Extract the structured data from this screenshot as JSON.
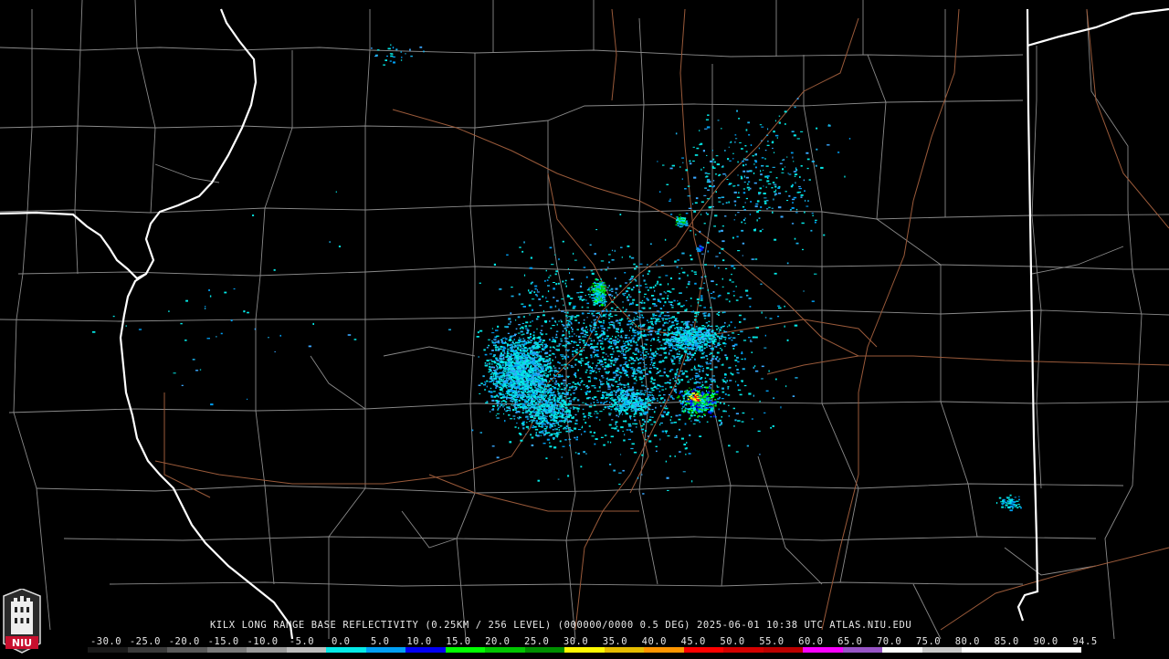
{
  "title": "KILX LONG RANGE BASE REFLECTIVITY (0.25KM / 256 LEVEL) (000000/0000 0.5 DEG) 2025-06-01 10:38 UTC  ATLAS.NIU.EDU",
  "logo": {
    "text": "NIU",
    "icon": "niu-castle-icon"
  },
  "scale": {
    "labels": [
      "-30.0",
      "-25.0",
      "-20.0",
      "-15.0",
      "-10.0",
      "-5.0",
      "0.0",
      "5.0",
      "10.0",
      "15.0",
      "20.0",
      "25.0",
      "30.0",
      "35.0",
      "40.0",
      "45.0",
      "50.0",
      "55.0",
      "60.0",
      "65.0",
      "70.0",
      "75.0",
      "80.0",
      "85.0",
      "90.0",
      "94.5"
    ],
    "colors": [
      "#1a1a1a",
      "#3a3a3a",
      "#5a5a5a",
      "#7a7a7a",
      "#9a9a9a",
      "#bcbcbc",
      "#04e9e7",
      "#019ff4",
      "#0300f4",
      "#02fd02",
      "#01c501",
      "#008e00",
      "#fdf802",
      "#e5bc00",
      "#fd9500",
      "#fd0000",
      "#d40000",
      "#bc0000",
      "#f800fd",
      "#9854c6",
      "#fdfdfd",
      "#c8c8c8",
      "#ffffff",
      "#ffffff",
      "#ffffff"
    ]
  },
  "colors": {
    "background": "#000000",
    "county_lines": "#8a8a8a",
    "state_lines": "#ffffff",
    "highways": "#9a5a3a"
  }
}
